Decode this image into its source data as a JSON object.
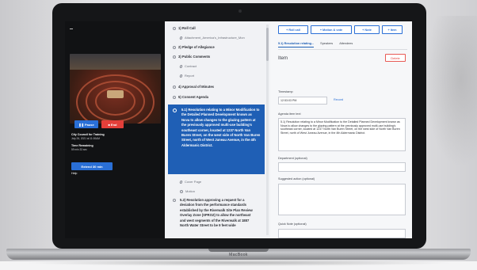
{
  "device": {
    "brand_label": "MacBook"
  },
  "video": {
    "pause_label": "Pause",
    "end_label": "End",
    "meeting_name": "City Council for Training",
    "meeting_date": "July 26, 2021 at 11:00AM",
    "time_remaining_label": "Time Remaining",
    "time_remaining_value": "59 min 33 sec",
    "extend_label": "Extend 30 min",
    "help_label": "Help"
  },
  "agenda": {
    "items": [
      {
        "label": "1) Roll Call"
      },
      {
        "label": "Attachment_America's_Infrastructure_Mon"
      },
      {
        "label": "2) Pledge of Allegiance"
      },
      {
        "label": "3) Public Comments"
      },
      {
        "label": "Contract"
      },
      {
        "label": "Report"
      },
      {
        "label": "4) Approval of Minutes"
      },
      {
        "label": "5) Consent Agenda"
      }
    ],
    "active_item": "5.1) Resolution relating to a Minor Modification to the Detailed Planned Development known as Nova to allow changes to the glazing pattern at the previously approved multi-use building's southeast corner, located at 1237 North Van Buren Street, on the west side of North Van Buren Street, north of West Juneau Avenue, in the 4th Aldermanic District.",
    "sub_items": [
      {
        "label": "Cover Page"
      },
      {
        "label": "Motion"
      }
    ],
    "next_item": "5.2) Resolution approving a request for a deviation from the performance standards established by the Riverwalk Site Plan Review Overlay Zone (SPROZ) to allow the northeast and west segments of the Riverwalk at 1887 North Water Street to be 9 feet wide"
  },
  "toolbar": {
    "roll_call": "Roll call",
    "motion_vote": "Motion & vote",
    "note": "Note",
    "item": "+ Item"
  },
  "tabs": [
    {
      "label": "5.1) Resolution relating..."
    },
    {
      "label": "Speakers"
    },
    {
      "label": "Attendees"
    }
  ],
  "detail": {
    "title": "Item",
    "delete_label": "Delete",
    "timestamp_label": "Timestamp",
    "timestamp_value": "12:53:03 PM",
    "record_label": "Record",
    "agenda_text_label": "Agenda item text",
    "agenda_text_value": "5.1) Resolution relating to a Minor Modification to the Detailed Planned Development known as Nova to allow changes to the glazing pattern at the previously approved multi-use building's southeast corner, located at 1237 North Van Buren Street, on the west side of North Van Buren Street, north of West Juneau Avenue, in the 4th Aldermanic District.",
    "department_label": "Department (optional)",
    "department_value": "",
    "suggested_label": "Suggested action (optional)",
    "suggested_value": "",
    "quicknote_label": "Quick Note (optional)",
    "quicknote_value": ""
  },
  "colors": {
    "accent": "#2a6fd6",
    "active_bg": "#1f5fb5",
    "danger": "#e33f3a"
  }
}
